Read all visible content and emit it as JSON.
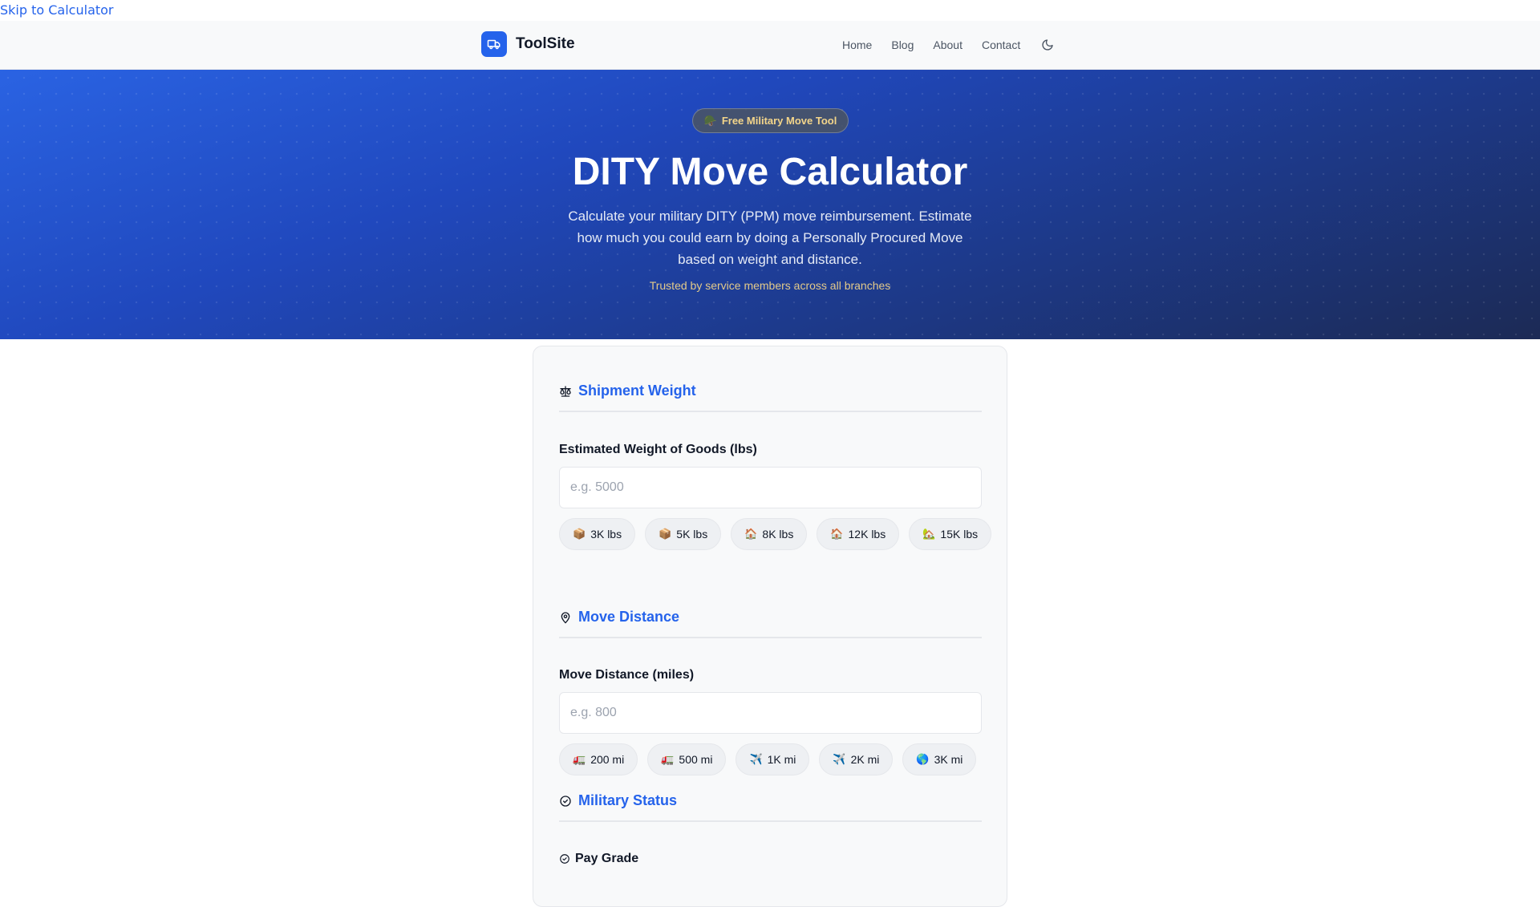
{
  "skip_link": "Skip to Calculator",
  "header": {
    "brand": "ToolSite",
    "nav": [
      "Home",
      "Blog",
      "About",
      "Contact"
    ],
    "theme_icon": "moon-icon"
  },
  "hero": {
    "badge_icon": "🪖",
    "badge": "Free Military Move Tool",
    "title": "DITY Move Calculator",
    "description": "Calculate your military DITY (PPM) move reimbursement. Estimate how much you could earn by doing a Personally Procured Move based on weight and distance.",
    "trust": "Trusted by service members across all branches"
  },
  "calculator": {
    "weight_section": {
      "title": "Shipment Weight",
      "icon": "scale-icon",
      "label": "Estimated Weight of Goods (lbs)",
      "placeholder": "e.g. 5000",
      "value": "",
      "presets": [
        {
          "emoji": "📦",
          "label": "3K lbs"
        },
        {
          "emoji": "📦",
          "label": "5K lbs"
        },
        {
          "emoji": "🏠",
          "label": "8K lbs"
        },
        {
          "emoji": "🏠",
          "label": "12K lbs"
        },
        {
          "emoji": "🏡",
          "label": "15K lbs"
        }
      ]
    },
    "distance_section": {
      "title": "Move Distance",
      "icon": "map-pin-icon",
      "label": "Move Distance (miles)",
      "placeholder": "e.g. 800",
      "value": "",
      "presets": [
        {
          "emoji": "🚛",
          "label": "200 mi"
        },
        {
          "emoji": "🚛",
          "label": "500 mi"
        },
        {
          "emoji": "✈️",
          "label": "1K mi"
        },
        {
          "emoji": "✈️",
          "label": "2K mi"
        },
        {
          "emoji": "🌎",
          "label": "3K mi"
        }
      ]
    },
    "status_section": {
      "title": "Military Status",
      "icon": "check-circle-icon",
      "pay_grade_label": "Pay Grade"
    }
  },
  "colors": {
    "accent": "#2563eb",
    "hero_start": "#2a63e3",
    "hero_end": "#1c2a55",
    "badge_text": "#f3d58a"
  }
}
